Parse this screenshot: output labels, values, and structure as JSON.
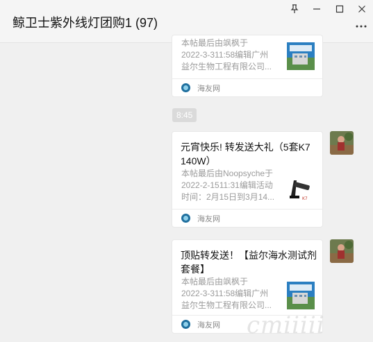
{
  "window": {
    "title": "鲸卫士紫外线灯团购1 (97)",
    "controls": [
      "pin-icon",
      "minimize-icon",
      "maximize-icon",
      "close-icon",
      "more-icon"
    ]
  },
  "messages": [
    {
      "type": "link-card",
      "partial": true,
      "title": "",
      "desc": "本帖最后由飒枫于\n2022-3-311:58编辑广州\n益尔生物工程有限公司...",
      "source": "海友网",
      "thumb": "building-thumbnail"
    },
    {
      "type": "timestamp",
      "text": "8:45"
    },
    {
      "type": "link-card",
      "title": "元宵快乐! 转发送大礼（5套K7 140W）",
      "desc": "本帖最后由Noopsyche于\n2022-2-1511:31编辑活动\n时间：2月15日到3月14...",
      "source": "海友网",
      "thumb": "lamp-thumbnail"
    },
    {
      "type": "link-card",
      "title": "顶贴转发送！【益尔海水测试剂套餐】",
      "desc": "本帖最后由飒枫于\n2022-3-311:58编辑广州\n益尔生物工程有限公司...",
      "source": "海友网",
      "thumb": "building-thumbnail"
    }
  ],
  "watermark": "cmiiiii",
  "colors": {
    "background": "#f0f0f0",
    "card": "#ffffff",
    "timestamp_bg": "#dadada",
    "source_icon": "#1f6f9e"
  }
}
